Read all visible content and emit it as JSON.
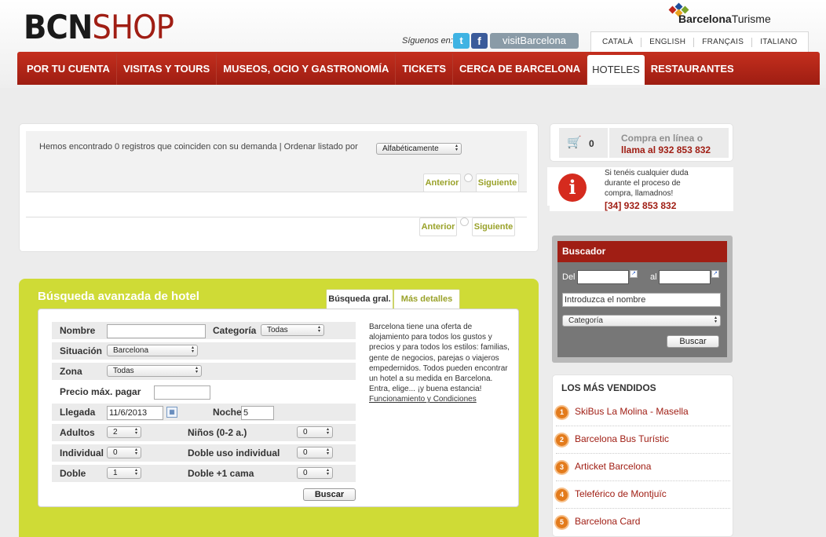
{
  "header": {
    "logo": {
      "part1": "BCN",
      "part2": "SHOP"
    },
    "brand": {
      "part1": "Barcelona",
      "part2": "Turisme",
      "colors": [
        "#c0261b",
        "#1e4f9c",
        "#7aa328",
        "#e8a21c"
      ]
    },
    "follow_label": "Síguenos en:",
    "social": [
      "twitter-icon",
      "facebook-icon"
    ],
    "visit_label": "visitBarcelona",
    "languages": [
      "CATALÀ",
      "ENGLISH",
      "FRANÇAIS",
      "ITALIANO"
    ]
  },
  "nav": {
    "items": [
      "POR TU CUENTA",
      "VISITAS Y TOURS",
      "MUSEOS, OCIO Y GASTRONOMÍA",
      "TICKETS",
      "CERCA DE BARCELONA",
      "HOTELES",
      "RESTAURANTES"
    ],
    "active": "HOTELES"
  },
  "results": {
    "summary": "Hemos encontrado 0 registros que coinciden con su demanda | Ordenar listado por",
    "sort_value": "Alfabéticamente",
    "prev": "Anterior",
    "next": "Siguiente"
  },
  "advanced": {
    "title": "Búsqueda avanzada de hotel",
    "tabs": [
      "Búsqueda gral.",
      "Más detalles"
    ],
    "labels": {
      "nombre": "Nombre",
      "categoria": "Categoría",
      "situacion": "Situación",
      "zona": "Zona",
      "precio": "Precio máx. pagar",
      "llegada": "Llegada",
      "noche": "Noche",
      "adultos": "Adultos",
      "ninos": "Niños (0-2 a.)",
      "individual": "Individual",
      "doble_uso": "Doble uso individual",
      "doble": "Doble",
      "doble_cama": "Doble +1 cama"
    },
    "values": {
      "categoria": "Todas",
      "situacion": "Barcelona",
      "zona": "Todas",
      "llegada": "11/6/2013",
      "noche": "5",
      "adultos": "2",
      "ninos": "0",
      "individual": "0",
      "doble_uso": "0",
      "doble": "1",
      "doble_cama": "0"
    },
    "submit": "Buscar",
    "description": "Barcelona tiene una oferta de alojamiento para todos los gustos y precios y para todos los estilos: familias, gente de negocios, parejas o viajeros empedernidos. Todos pueden encontrar un hotel a su medida en Barcelona. Entra, elige... ¡y buena estancia!",
    "link": "Funcionamiento y Condiciones"
  },
  "sidebar": {
    "cart": {
      "count": "0",
      "line1": "Compra en línea o",
      "line2": "llama al 932 853 832"
    },
    "info": {
      "text": "Si tenéis cualquier duda durante el proceso de compra, llamadnos!",
      "phone": "[34] 932 853 832"
    },
    "buscador": {
      "title": "Buscador",
      "del": "Del",
      "al": "al",
      "name_placeholder": "Introduzca el nombre",
      "category": "Categoría",
      "submit": "Buscar"
    },
    "vendidos": {
      "title": "LOS MÁS VENDIDOS",
      "items": [
        "SkiBus La Molina - Masella",
        "Barcelona Bus Turístic",
        "Articket Barcelona",
        "Teleférico de Montjuïc",
        "Barcelona Card"
      ]
    }
  }
}
